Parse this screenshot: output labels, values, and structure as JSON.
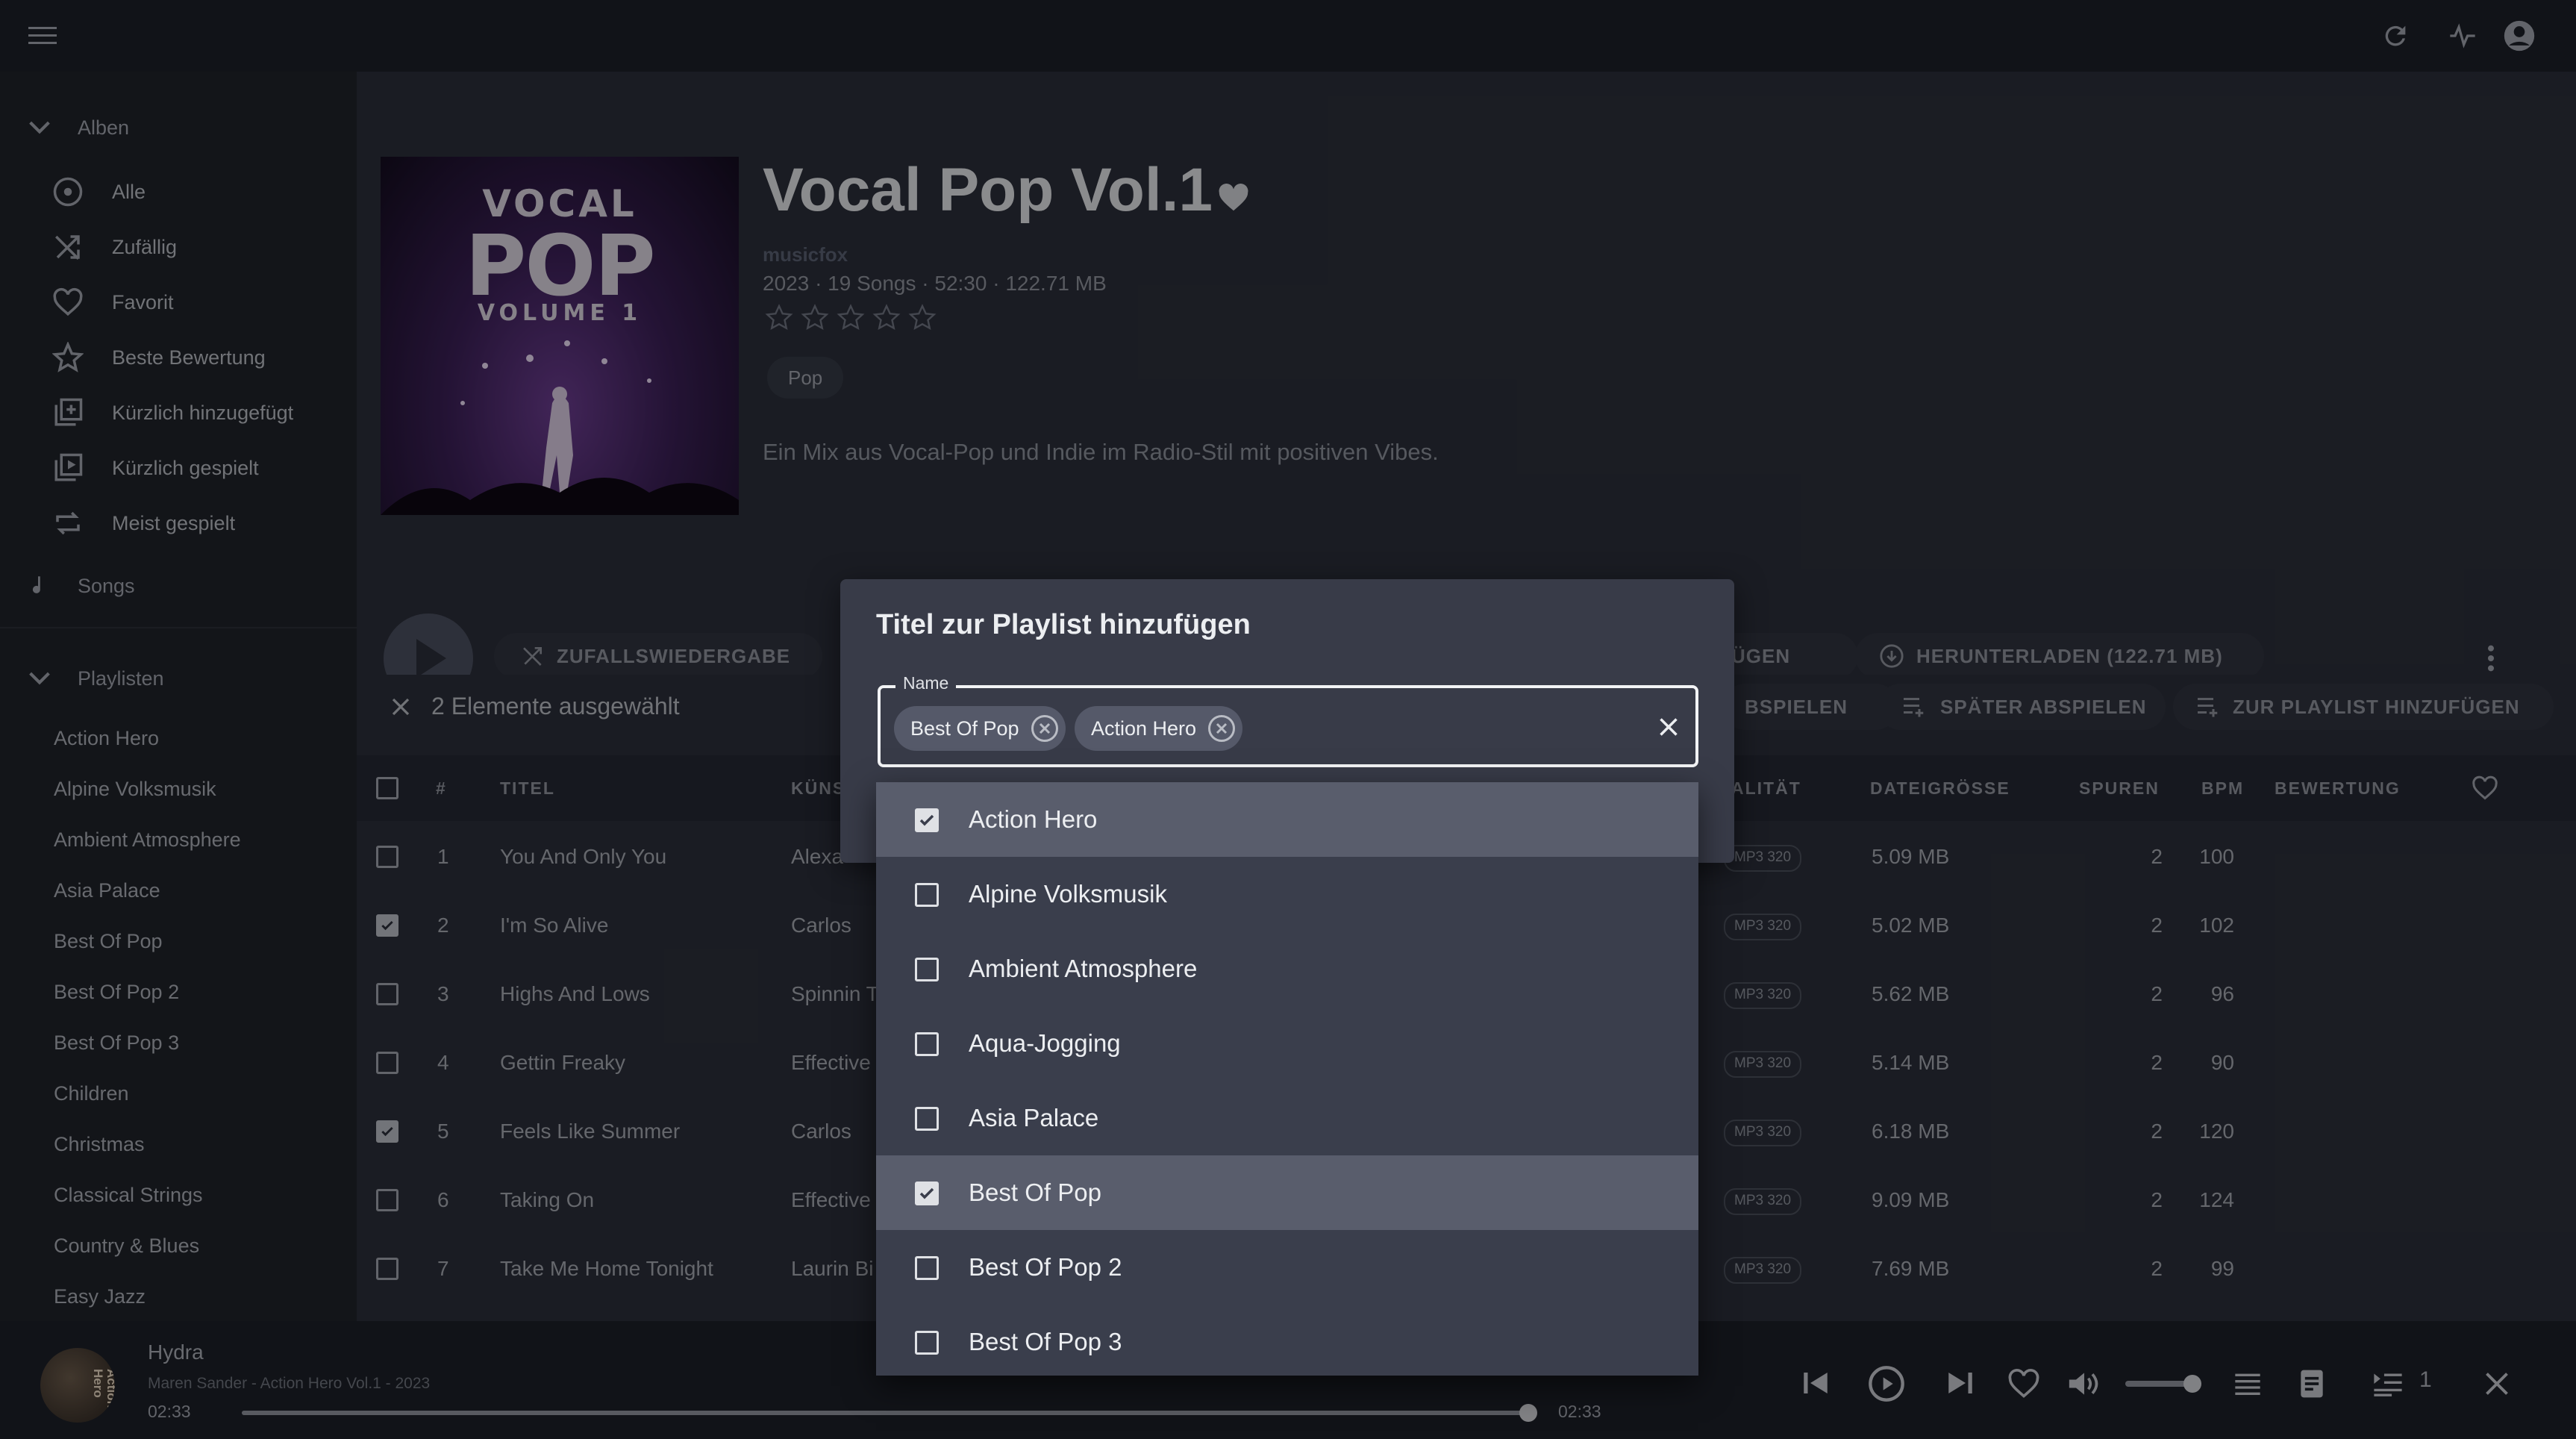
{
  "album": {
    "title": "Vocal Pop Vol.1",
    "artist": "musicfox",
    "meta": "2023 · 19 Songs · 52:30 · 122.71 MB",
    "genre": "Pop",
    "description": "Ein Mix aus Vocal-Pop und Indie im Radio-Stil mit positiven Vibes.",
    "cover_line1": "VOCAL",
    "cover_line2": "POP",
    "cover_line3": "VOLUME 1"
  },
  "sidebar": {
    "albums_header": "Alben",
    "items": [
      {
        "label": "Alle",
        "icon": "disc-icon"
      },
      {
        "label": "Zufällig",
        "icon": "shuffle-icon"
      },
      {
        "label": "Favorit",
        "icon": "heart-icon"
      },
      {
        "label": "Beste Bewertung",
        "icon": "star-icon"
      },
      {
        "label": "Kürzlich hinzugefügt",
        "icon": "library-add-icon"
      },
      {
        "label": "Kürzlich gespielt",
        "icon": "library-play-icon"
      },
      {
        "label": "Meist gespielt",
        "icon": "repeat-icon"
      }
    ],
    "songs_label": "Songs",
    "playlists_header": "Playlisten",
    "playlists": [
      "Action Hero",
      "Alpine Volksmusik",
      "Ambient Atmosphere",
      "Asia Palace",
      "Best Of Pop",
      "Best Of Pop 2",
      "Best Of Pop 3",
      "Children",
      "Christmas",
      "Classical Strings",
      "Country & Blues",
      "Easy Jazz"
    ]
  },
  "toolbar": {
    "shuffle_label": "ZUFALLSWIEDERGABE",
    "add_next_label": "ÜGEN",
    "download_label": "HERUNTERLADEN (122.71 MB)"
  },
  "selection": {
    "count_label": "2 Elemente ausgewählt",
    "play_next_label": "BSPIELEN",
    "play_later_label": "SPÄTER ABSPIELEN",
    "add_to_playlist_label": "ZUR PLAYLIST HINZUFÜGEN"
  },
  "table": {
    "headers": {
      "num": "#",
      "title": "TITEL",
      "artist": "KÜNS",
      "quality": "ALITÄT",
      "size": "DATEIGRÖSSE",
      "tracks": "SPUREN",
      "bpm": "BPM",
      "rating": "BEWERTUNG"
    },
    "rows": [
      {
        "num": "1",
        "title": "You And Only You",
        "artist": "Alexa",
        "quality": "MP3 320",
        "size": "5.09 MB",
        "tracks": "2",
        "bpm": "100",
        "checked": false
      },
      {
        "num": "2",
        "title": "I'm So Alive",
        "artist": "Carlos",
        "quality": "MP3 320",
        "size": "5.02 MB",
        "tracks": "2",
        "bpm": "102",
        "checked": true
      },
      {
        "num": "3",
        "title": "Highs And Lows",
        "artist": "Spinnin T",
        "quality": "MP3 320",
        "size": "5.62 MB",
        "tracks": "2",
        "bpm": "96",
        "checked": false
      },
      {
        "num": "4",
        "title": "Gettin Freaky",
        "artist": "Effective",
        "quality": "MP3 320",
        "size": "5.14 MB",
        "tracks": "2",
        "bpm": "90",
        "checked": false
      },
      {
        "num": "5",
        "title": "Feels Like Summer",
        "artist": "Carlos",
        "quality": "MP3 320",
        "size": "6.18 MB",
        "tracks": "2",
        "bpm": "120",
        "checked": true
      },
      {
        "num": "6",
        "title": "Taking On",
        "artist": "Effective",
        "quality": "MP3 320",
        "size": "9.09 MB",
        "tracks": "2",
        "bpm": "124",
        "checked": false
      },
      {
        "num": "7",
        "title": "Take Me Home Tonight",
        "artist": "Laurin Bi",
        "quality": "MP3 320",
        "size": "7.69 MB",
        "tracks": "2",
        "bpm": "99",
        "checked": false
      }
    ]
  },
  "dialog": {
    "title": "Titel zur Playlist hinzufügen",
    "field_label": "Name",
    "chips": [
      "Best Of Pop",
      "Action Hero"
    ],
    "options": [
      {
        "label": "Action Hero",
        "checked": true
      },
      {
        "label": "Alpine Volksmusik",
        "checked": false
      },
      {
        "label": "Ambient Atmosphere",
        "checked": false
      },
      {
        "label": "Aqua-Jogging",
        "checked": false
      },
      {
        "label": "Asia Palace",
        "checked": false
      },
      {
        "label": "Best Of Pop",
        "checked": true
      },
      {
        "label": "Best Of Pop 2",
        "checked": false
      },
      {
        "label": "Best Of Pop 3",
        "checked": false
      }
    ]
  },
  "player": {
    "track_title": "Hydra",
    "track_sub": "Maren Sander - Action Hero Vol.1 - 2023",
    "time_current": "02:33",
    "time_total": "02:33",
    "progress": 1.0,
    "volume": 0.9,
    "queue_count": "1",
    "cover_text": "Action Hero"
  },
  "colors": {
    "accent": "#5a6072",
    "background": "#2b2e39",
    "sidebar": "#1f2229",
    "dialog": "#383b48"
  }
}
